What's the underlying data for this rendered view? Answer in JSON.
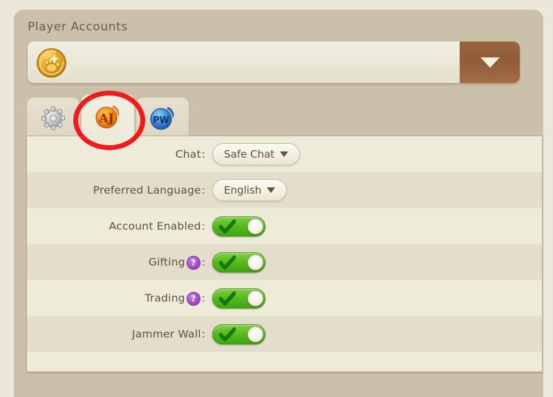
{
  "section": {
    "label": "Player Accounts"
  },
  "account_selector": {
    "avatar_icon": "paw-badge-icon",
    "selected_account": "",
    "dropdown_icon": "caret-down-icon"
  },
  "tabs": [
    {
      "id": "settings",
      "icon": "gear-icon",
      "label": "",
      "active": false
    },
    {
      "id": "animal-jam",
      "icon": "aj-logo-icon",
      "label": "AJ",
      "active": true
    },
    {
      "id": "play-wild",
      "icon": "pw-logo-icon",
      "label": "PW",
      "active": false
    }
  ],
  "settings": [
    {
      "label": "Chat",
      "help": false,
      "control": "dropdown",
      "value": "Safe Chat",
      "caret_icon": "caret-down-icon"
    },
    {
      "label": "Preferred Language",
      "help": false,
      "control": "dropdown",
      "value": "English",
      "caret_icon": "caret-down-icon"
    },
    {
      "label": "Account Enabled",
      "help": false,
      "control": "toggle",
      "value": "on",
      "toggle_icon": "check-icon"
    },
    {
      "label": "Gifting",
      "help": true,
      "help_icon": "question-mark-icon",
      "help_glyph": "?",
      "control": "toggle",
      "value": "on",
      "toggle_icon": "check-icon"
    },
    {
      "label": "Trading",
      "help": true,
      "help_icon": "question-mark-icon",
      "help_glyph": "?",
      "control": "toggle",
      "value": "on",
      "toggle_icon": "check-icon"
    },
    {
      "label": "Jammer Wall",
      "help": false,
      "control": "toggle",
      "value": "on",
      "toggle_icon": "check-icon"
    }
  ],
  "annotation": {
    "shape": "ellipse",
    "color": "#f21b1b",
    "targets_tab": "animal-jam"
  },
  "colors": {
    "page_background": "#ece8d9",
    "panel_background": "#cbc0a8",
    "row_light": "#efebda",
    "row_dark": "#e3decb",
    "text": "#5e4f3f",
    "dropdown_button": "#915c38",
    "toggle_on": "#57bc1d",
    "help_icon": "#a54bc8",
    "annotation": "#f21b1b"
  },
  "label_colon": ":"
}
